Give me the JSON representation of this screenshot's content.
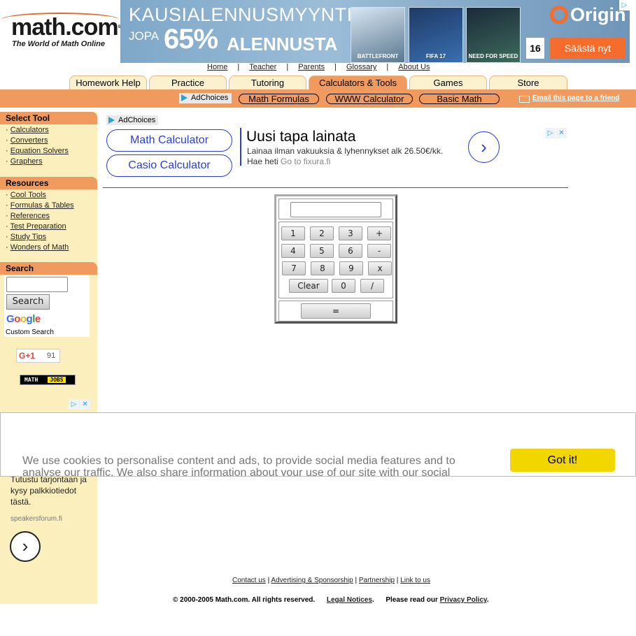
{
  "logo": {
    "brand": "math.com",
    "sm": "SM",
    "tagline": "The World of Math Online"
  },
  "top_banner": {
    "headline": "KAUSIALENNUSMYYNTI",
    "prefix": "JOPA",
    "percent": "65%",
    "suffix": "ALENNUSTA",
    "tiles": [
      "BATTLEFRONT",
      "FIFA 17",
      "NEED FOR SPEED"
    ],
    "brand": "Origin",
    "age": "16",
    "cta": "Säästä nyt"
  },
  "top_links": [
    "Home",
    "Teacher",
    "Parents",
    "Glossary",
    "About Us"
  ],
  "top_link_sep": "|",
  "tabs": [
    {
      "label": "Homework Help",
      "active": false
    },
    {
      "label": "Practice",
      "active": false
    },
    {
      "label": "Tutoring",
      "active": false
    },
    {
      "label": "Calculators & Tools",
      "active": true
    },
    {
      "label": "Games",
      "active": false
    },
    {
      "label": "Store",
      "active": false
    }
  ],
  "subbar": {
    "adchoices": "AdChoices",
    "pills": [
      "Math Formulas",
      "WWW Calculator",
      "Basic Math"
    ],
    "email": "Email this page to a friend"
  },
  "sidebar": {
    "select_tool": {
      "title": "Select Tool",
      "items": [
        "Calculators",
        "Converters",
        "Equation Solvers",
        "Graphers"
      ]
    },
    "resources": {
      "title": "Resources",
      "items": [
        "Cool Tools",
        "Formulas & Tables",
        "References",
        "Test Preparation",
        "Study Tips",
        "Wonders of Math"
      ]
    },
    "search": {
      "title": "Search",
      "button": "Search",
      "google": "Google",
      "custom": "Custom Search"
    },
    "gplus": {
      "label": "G+1",
      "count": "91"
    },
    "math_jobs": {
      "left": "MATH",
      "right": "JOBS"
    },
    "ad": {
      "text": "Tutustu tarjontaan ja kysy palkkiotiedot tästä.",
      "url": "speakersforum.fi",
      "arrow": "›"
    }
  },
  "main_ad": {
    "adchoices": "AdChoices",
    "buttons": [
      "Math Calculator",
      "Casio Calculator"
    ],
    "title": "Uusi tapa lainata",
    "desc": "Lainaa ilman vakuuksia & lyhennykset alk 26.50€/kk. Hae heti",
    "go": "Go to fixura.fi",
    "arrow": "›"
  },
  "ad_icons": {
    "choice": "▷",
    "close": "✕"
  },
  "calculator": {
    "rows": [
      [
        "1",
        "2",
        "3",
        "+"
      ],
      [
        "4",
        "5",
        "6",
        "-"
      ],
      [
        "7",
        "8",
        "9",
        "x"
      ]
    ],
    "clear": "Clear",
    "zero": "0",
    "divide": "/",
    "equals": "="
  },
  "cookie": {
    "text": "We use cookies to personalise content and ads, to provide social media features and to analyse our traffic. We also share information about your use of our site with our social",
    "button": "Got it!"
  },
  "footer": {
    "links": [
      "Contact us",
      "Advertising & Sponsorship",
      "Partnership",
      "Link to us"
    ],
    "copyright": "© 2000-2005 Math.com. All rights reserved.",
    "legal": "Legal Notices",
    "read": "Please read our",
    "privacy": "Privacy Policy"
  },
  "colors": {
    "accent": "#f09a5d",
    "sidebar_bg": "#fcefbe",
    "ad_blue": "#2b3fd4",
    "cookie_btn": "#f2d600"
  }
}
